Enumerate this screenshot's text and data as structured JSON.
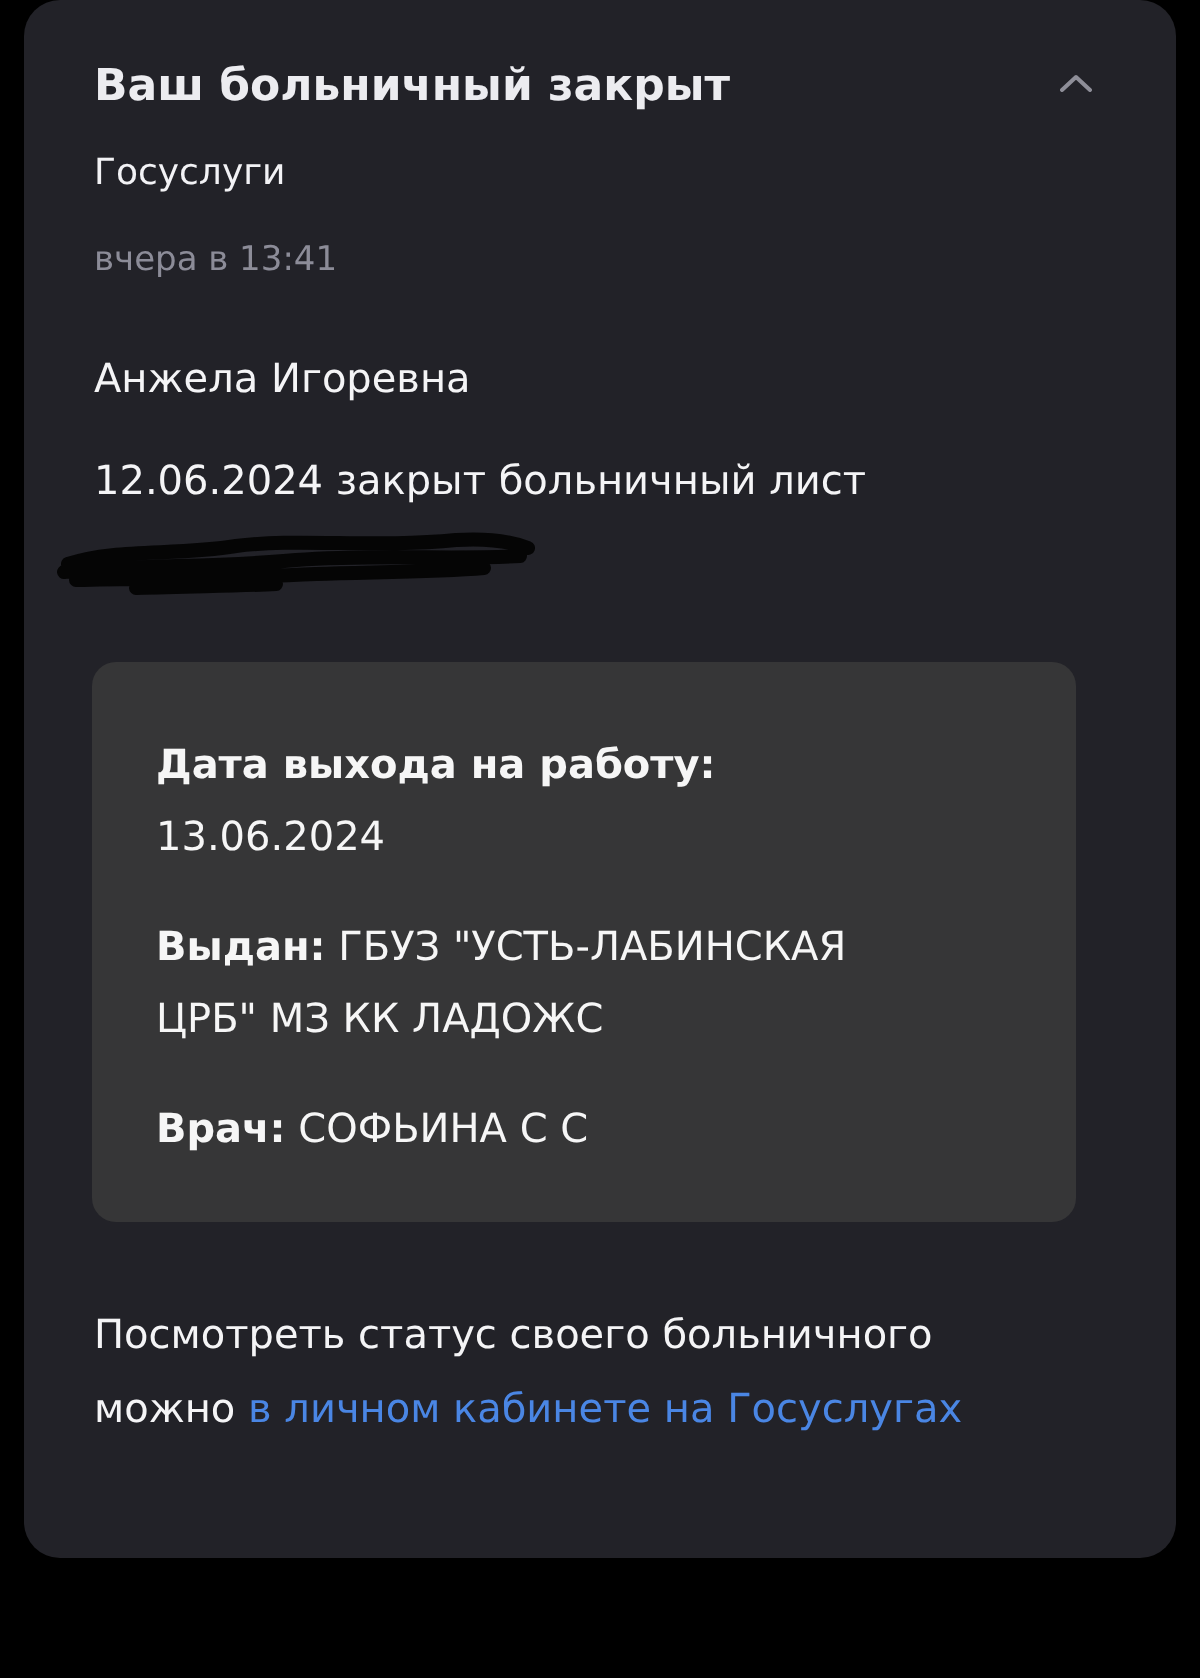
{
  "notification": {
    "title": "Ваш больничный закрыт",
    "expanded": true,
    "sender": "Госуслуги",
    "time": "вчера в 13:41",
    "recipient": "Анжела Игоревна",
    "message": "12.06.2024 закрыт больничный лист",
    "details": [
      "**Дата выхода на работу:** 13.06.2024",
      "**Выдан:** ГБУЗ \"УСТЬ-ЛАБИНСКАЯ ЦРБ\" МЗ КК ЛАДОЖС",
      "**Врач:** СОФЬИНА С С"
    ],
    "footer": {
      "text": "Посмотреть статус своего больничного можно",
      "link": "в личном кабинете на Госуслугах"
    }
  }
}
